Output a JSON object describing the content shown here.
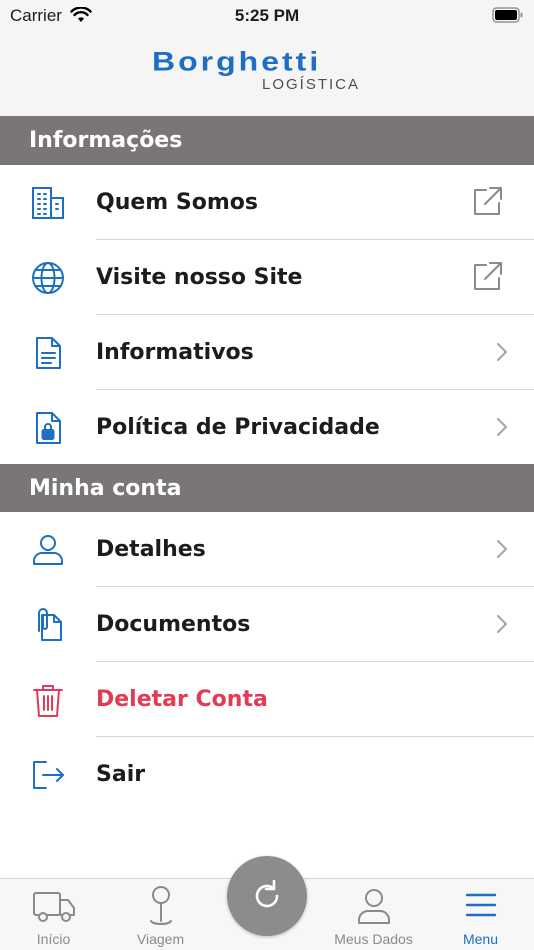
{
  "status_bar": {
    "carrier": "Carrier",
    "time": "5:25 PM"
  },
  "brand": {
    "name": "Borghetti",
    "subtitle": "LOGÍSTICA",
    "color": "#1d6fc4"
  },
  "sections": [
    {
      "title": "Informações",
      "items": [
        {
          "label": "Quem Somos",
          "icon": "building-icon",
          "trailing": "external-link-icon"
        },
        {
          "label": "Visite nosso Site",
          "icon": "globe-icon",
          "trailing": "external-link-icon"
        },
        {
          "label": "Informativos",
          "icon": "document-icon",
          "trailing": "chevron-right-icon"
        },
        {
          "label": "Política de Privacidade",
          "icon": "document-lock-icon",
          "trailing": "chevron-right-icon"
        }
      ]
    },
    {
      "title": "Minha conta",
      "items": [
        {
          "label": "Detalhes",
          "icon": "user-icon",
          "trailing": "chevron-right-icon"
        },
        {
          "label": "Documentos",
          "icon": "paperclip-document-icon",
          "trailing": "chevron-right-icon"
        },
        {
          "label": "Deletar Conta",
          "icon": "trash-icon",
          "trailing": "",
          "color": "#e23b55"
        },
        {
          "label": "Sair",
          "icon": "logout-icon",
          "trailing": ""
        }
      ]
    }
  ],
  "tab_bar": {
    "tabs": [
      {
        "label": "Início",
        "icon": "truck-icon",
        "active": false
      },
      {
        "label": "Viagem",
        "icon": "location-pin-icon",
        "active": false
      },
      {
        "label": "Meus Dados",
        "icon": "user-icon",
        "active": false
      },
      {
        "label": "Menu",
        "icon": "hamburger-menu-icon",
        "active": true
      }
    ],
    "center_action_icon": "refresh-icon"
  },
  "colors": {
    "accent": "#1d6fc4",
    "section_header": "#7b7676",
    "danger": "#e23b55",
    "inactive": "#8a8a8e"
  }
}
